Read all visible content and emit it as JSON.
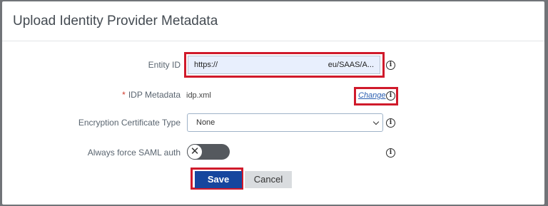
{
  "dialog": {
    "title": "Upload Identity Provider Metadata"
  },
  "form": {
    "entity_id": {
      "label": "Entity ID",
      "value_start": "https://",
      "value_end": "eu/SAAS/A..."
    },
    "idp_metadata": {
      "required_mark": "*",
      "label": "IDP Metadata",
      "file_name": "idp.xml",
      "change_label": "Change"
    },
    "encryption_certificate_type": {
      "label": "Encryption Certificate Type",
      "selected": "None"
    },
    "always_force_saml_auth": {
      "label": "Always force SAML auth",
      "state": "off"
    }
  },
  "buttons": {
    "save": "Save",
    "cancel": "Cancel"
  },
  "colors": {
    "highlight": "#d01a2b",
    "save_button": "#16469e",
    "link": "#2a5db0"
  },
  "icons": [
    "info-icon",
    "close-x-icon",
    "chevron-down-icon"
  ]
}
